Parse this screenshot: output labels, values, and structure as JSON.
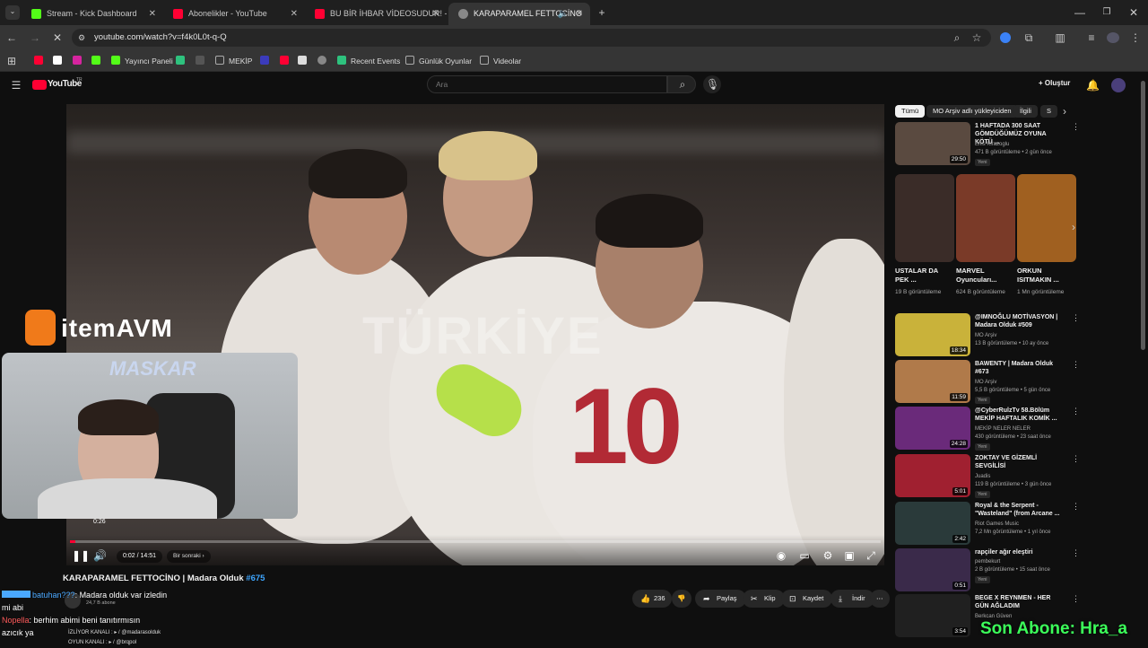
{
  "browser": {
    "tabs": [
      {
        "label": "Stream - Kick Dashboard",
        "color": "#53fc18"
      },
      {
        "label": "Abonelikler - YouTube",
        "color": "#ff0033"
      },
      {
        "label": "BU BİR İHBAR VİDEOSUDUR! -",
        "color": "#ff0033"
      },
      {
        "label": "KARAPARAMEL FETTOCİNO",
        "color": "#888888"
      }
    ],
    "url": "youtube.com/watch?v=f4k0L0t-q-Q",
    "bookmarks": [
      {
        "label": "Yayıncı Paneli",
        "color": "#53fc18"
      },
      {
        "label": "MEKİP",
        "color": "#aaaaaa"
      },
      {
        "label": "Recent Events",
        "color": "#2ec27e"
      },
      {
        "label": "Günlük Oyunlar",
        "color": "#aaaaaa"
      },
      {
        "label": "Videolar",
        "color": "#aaaaaa"
      }
    ]
  },
  "youtube": {
    "logo": "YouTube",
    "logo_sup": "TR",
    "search_placeholder": "Ara",
    "create_label": "Oluştur"
  },
  "player": {
    "overlay_text": "TÜRKİYE",
    "jersey_number": "10",
    "time": "0:02 / 14:51",
    "hover_time": "0:26",
    "chapter": "Bir sonraki",
    "progress": 0.002
  },
  "video": {
    "title": "KARAPARAMEL FETTOCİNO | Madara Olduk",
    "tag": "#675",
    "subs": "24,7 B abone",
    "likes": "236",
    "share": "Paylaş",
    "clip": "Klip",
    "save": "Kaydet",
    "download": "İndir"
  },
  "chips": [
    "Tümü",
    "MO Arşiv adlı yükleyiciden",
    "İlgili",
    "S"
  ],
  "related": [
    {
      "title": "1 HAFTADA 300 SAAT GÖMDÜĞÜMÜZ OYUNA KÖTÜ ...",
      "channel": "Enis Kirazoglu",
      "meta": "471 B görüntüleme • 2 gün önce",
      "duration": "29:50",
      "new": "Yeni",
      "color": "#5a4a40"
    },
    {
      "title": "@IMNOĞLU MOTİVASYON | Madara Olduk #509",
      "channel": "MO Arşiv",
      "meta": "13 B görüntüleme • 10 ay önce",
      "duration": "18:34",
      "new": "",
      "color": "#c9b23a"
    },
    {
      "title": "BAWENTY | Madara Olduk #673",
      "channel": "MO Arşiv",
      "meta": "5,5 B görüntüleme • 5 gün önce",
      "duration": "11:59",
      "new": "Yeni",
      "color": "#b07a4a"
    },
    {
      "title": "@CyberRulzTv 58.Bölüm MEKİP HAFTALIK KOMİK ...",
      "channel": "MEKİP NELER NELER",
      "meta": "430 görüntüleme • 23 saat önce",
      "duration": "24:28",
      "new": "Yeni",
      "color": "#6a2a7a"
    },
    {
      "title": "ZOKTAY VE GİZEMLİ SEVGİLİSİ",
      "channel": "Juadis",
      "meta": "119 B görüntüleme • 3 gün önce",
      "duration": "5:01",
      "new": "Yeni",
      "color": "#a02030"
    },
    {
      "title": "Royal & the Serpent - \"Wasteland\" (from Arcane ...",
      "channel": "Riot Games Music",
      "meta": "7,2 Mn görüntüleme • 1 yıl önce",
      "duration": "2:42",
      "new": "",
      "color": "#2a3a3a"
    },
    {
      "title": "rapçiler ağır eleştiri",
      "channel": "pembekurt",
      "meta": "2 B görüntüleme • 15 saat önce",
      "duration": "0:51",
      "new": "Yeni",
      "color": "#3a2a4a"
    },
    {
      "title": "BEGE X REYNMEN - HER GÜN AĞLADIM",
      "channel": "Berkcan Güven",
      "meta": "",
      "duration": "3:54",
      "new": "",
      "color": "#202020"
    }
  ],
  "shorts": [
    {
      "title": "USTALAR DA PEK ...",
      "views": "19 B görüntüleme",
      "color": "#3a2c28"
    },
    {
      "title": "MARVEL Oyuncuları...",
      "views": "624 B görüntüleme",
      "color": "#7a3a28"
    },
    {
      "title": "ORKUN ISITMAKIN ...",
      "views": "1 Mn görüntüleme",
      "color": "#a06020"
    }
  ],
  "overlays": {
    "sponsor": "itemAVM",
    "cam_label": "MASKAR",
    "chat": [
      {
        "user": "batuhan???",
        "msg": ": Madara olduk var izledin",
        "color": "#4aa8ff"
      },
      {
        "user": "",
        "msg": "mi abi",
        "color": "#ffffff"
      },
      {
        "user": "Nopella",
        "msg": ": berhim abimi beni tanıtırmısın",
        "color": "#ff5a5a"
      },
      {
        "user": "",
        "msg": "azıcık ya",
        "color": "#ffffff"
      }
    ],
    "desc_lines": [
      "İZLİYOR KANALI : ▸ / @madarasolduk",
      "OYUN KANALI : ▸ / @brqpol"
    ],
    "sub_text": "Son Abone: Hra_a"
  }
}
